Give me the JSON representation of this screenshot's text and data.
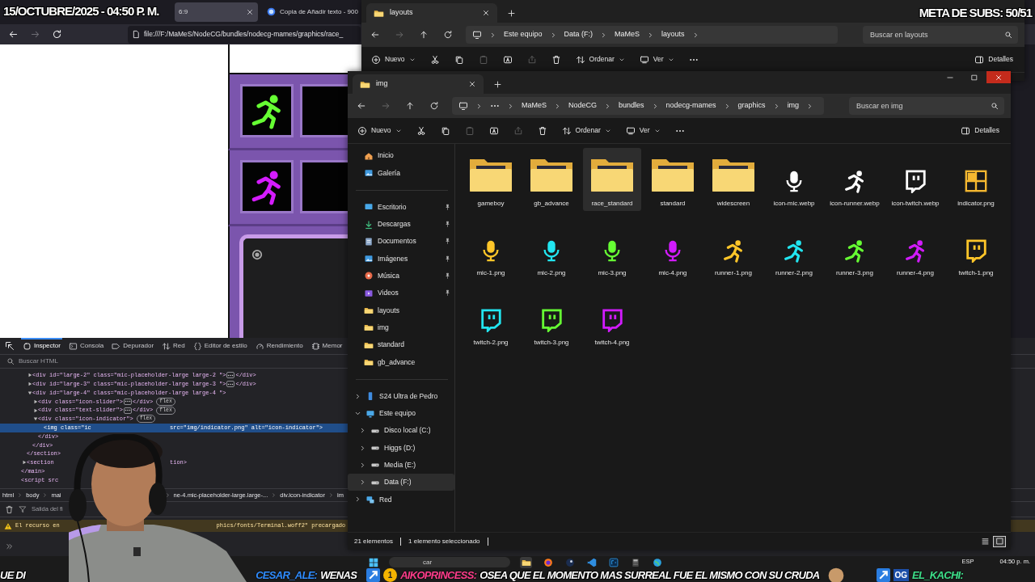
{
  "overlay": {
    "date": "15/OCTUBRE/2025 - 04:50 P. M.",
    "sub_goal": "META DE SUBS: 50/51"
  },
  "browser": {
    "tabs": [
      {
        "label": "6:9",
        "selected": true
      },
      {
        "label": "Copia de Añadir texto - 900",
        "selected": false
      }
    ],
    "nav_buttons": [
      {
        "kind": "back",
        "disabled": false
      },
      {
        "kind": "forward",
        "disabled": true
      },
      {
        "kind": "refresh",
        "disabled": false
      }
    ],
    "url": "file:///F:/MaMeS/NodeCG/bundles/nodecg-mames/graphics/race_",
    "preview": {
      "runners": [
        {
          "color": "#66ff33"
        },
        {
          "color": "#d51cff"
        }
      ]
    },
    "devtools": {
      "tabs": [
        {
          "kind": "inspector",
          "label": "Inspector",
          "selected": true
        },
        {
          "kind": "console",
          "label": "Consola",
          "selected": false
        },
        {
          "kind": "debugger",
          "label": "Depurador",
          "selected": false
        },
        {
          "kind": "network",
          "label": "Red",
          "selected": false
        },
        {
          "kind": "style",
          "label": "Editor de estilo",
          "selected": false
        },
        {
          "kind": "performance",
          "label": "Rendimiento",
          "selected": false
        },
        {
          "kind": "memory",
          "label": "Memor",
          "selected": false
        }
      ],
      "search": {
        "placeholder": "Buscar HTML"
      },
      "tree": [
        {
          "close": "</main>",
          "children": [
            {
              "close": "</section>",
              "children": [
                {
                  "text": "<div id=\"large-2\" class=\"mic-placeholder-large large-2 \">",
                  "expanded": false,
                  "close": "</div>",
                  "selected": false
                },
                {
                  "text": "<div id=\"large-3\" class=\"mic-placeholder-large large-3 \">",
                  "expanded": false,
                  "close": "</div>",
                  "selected": false
                },
                {
                  "text": "<div id=\"large-4\" class=\"mic-placeholder-large large-4 \">",
                  "expanded": true,
                  "close": "</div>",
                  "selected": false,
                  "children": [
                    {
                      "text": "<div class=\"icon-slider\">",
                      "expanded": false,
                      "close": "</div>",
                      "badge": "flex",
                      "selected": false
                    },
                    {
                      "text": "<div class=\"text-slider\">",
                      "expanded": false,
                      "close": "</div>",
                      "badge": "flex",
                      "selected": false
                    },
                    {
                      "text": "<div class=\"icon-indicator\">",
                      "expanded": true,
                      "close": "</div>",
                      "badge": "flex",
                      "selected": false,
                      "children": [
                        {
                          "text": "<img class=\"ic",
                          "text_2": "src=\"img/indicator.png\" alt=\"icon-indicator\">",
                          "selected": true
                        }
                      ]
                    }
                  ]
                }
              ]
            },
            {
              "text": "<section",
              "text_2": "tion>",
              "expanded": false,
              "selected": false
            }
          ]
        },
        {
          "text": "<script src",
          "selected": false
        }
      ],
      "breadcrumb": {
        "left": [
          "html",
          "body",
          "mai"
        ],
        "right": [
          "ne-4.mic-placeholder-large.large-...",
          "div.icon-indicator",
          "im"
        ]
      },
      "filter": {
        "placeholder": "Salida del fi"
      },
      "messages": [
        {
          "kind": "warning",
          "text": "El recurso en",
          "text_2": "phics/fonts/Terminal.woff2\" precargado"
        }
      ]
    }
  },
  "explorers": [
    {
      "tab": "layouts",
      "nav_buttons": [
        {
          "kind": "back",
          "disabled": false
        },
        {
          "kind": "forward",
          "disabled": true
        },
        {
          "kind": "up",
          "disabled": false
        },
        {
          "kind": "refresh",
          "disabled": false
        }
      ],
      "breadcrumb_collapsed": false,
      "breadcrumb": [
        "Este equipo",
        "Data (F:)",
        "MaMeS",
        "layouts"
      ],
      "search": {
        "placeholder": "Buscar en layouts"
      },
      "commands": [
        {
          "kind": "new",
          "label": "Nuevo",
          "disabled": false
        },
        {
          "kind": "cut",
          "disabled": false
        },
        {
          "kind": "copy",
          "disabled": false
        },
        {
          "kind": "paste",
          "disabled": true
        },
        {
          "kind": "rename",
          "disabled": false
        },
        {
          "kind": "share",
          "disabled": true
        },
        {
          "kind": "delete",
          "disabled": false
        },
        {
          "kind": "sort",
          "label": "Ordenar",
          "disabled": false
        },
        {
          "kind": "view",
          "label": "Ver",
          "disabled": false
        },
        {
          "kind": "more",
          "disabled": false
        }
      ],
      "details": "Detalles"
    },
    {
      "tab": "img",
      "controls": [
        {
          "kind": "minimize",
          "hovered": false
        },
        {
          "kind": "maximize",
          "hovered": false
        },
        {
          "kind": "close",
          "hovered": true
        }
      ],
      "nav_buttons": [
        {
          "kind": "back",
          "disabled": false
        },
        {
          "kind": "forward",
          "disabled": true
        },
        {
          "kind": "up",
          "disabled": false
        },
        {
          "kind": "refresh",
          "disabled": false
        }
      ],
      "breadcrumb_collapsed": true,
      "breadcrumb": [
        "MaMeS",
        "NodeCG",
        "bundles",
        "nodecg-mames",
        "graphics",
        "img"
      ],
      "search": {
        "placeholder": "Buscar en img"
      },
      "commands": [
        {
          "kind": "new",
          "label": "Nuevo",
          "disabled": false
        },
        {
          "kind": "cut",
          "disabled": false
        },
        {
          "kind": "copy",
          "disabled": false
        },
        {
          "kind": "paste",
          "disabled": true
        },
        {
          "kind": "rename",
          "disabled": false
        },
        {
          "kind": "share",
          "disabled": true
        },
        {
          "kind": "delete",
          "disabled": false
        },
        {
          "kind": "sort",
          "label": "Ordenar",
          "disabled": false
        },
        {
          "kind": "view",
          "label": "Ver",
          "disabled": false
        },
        {
          "kind": "more",
          "disabled": false
        }
      ],
      "details": "Detalles",
      "quick_access": [
        {
          "label": "Inicio",
          "kind": "home",
          "selected": false
        },
        {
          "label": "Galería",
          "kind": "gallery",
          "selected": false
        }
      ],
      "pinned": [
        {
          "label": "Escritorio",
          "kind": "desktop",
          "pinned": true,
          "selected": false
        },
        {
          "label": "Descargas",
          "kind": "download",
          "pinned": true,
          "selected": false
        },
        {
          "label": "Documentos",
          "kind": "documents",
          "pinned": true,
          "selected": false
        },
        {
          "label": "Imágenes",
          "kind": "pictures",
          "pinned": true,
          "selected": false
        },
        {
          "label": "Música",
          "kind": "music",
          "pinned": true,
          "selected": false
        },
        {
          "label": "Videos",
          "kind": "videos",
          "pinned": true,
          "selected": false
        },
        {
          "label": "layouts",
          "kind": "folder",
          "pinned": false,
          "selected": false
        },
        {
          "label": "img",
          "kind": "folder",
          "pinned": false,
          "selected": false
        },
        {
          "label": "standard",
          "kind": "folder",
          "pinned": false,
          "selected": false
        },
        {
          "label": "gb_advance",
          "kind": "folder",
          "pinned": false,
          "selected": false
        }
      ],
      "tree": [
        {
          "label": "S24 Ultra de Pedro",
          "kind": "phone",
          "expanded": false,
          "selected": false
        },
        {
          "label": "Este equipo",
          "kind": "pc",
          "expanded": true,
          "selected": false,
          "children": [
            {
              "label": "Disco local (C:)",
              "kind": "drive",
              "expanded": false,
              "selected": false
            },
            {
              "label": "Higgs (D:)",
              "kind": "drive",
              "expanded": false,
              "selected": false
            },
            {
              "label": "Media (E:)",
              "kind": "drive",
              "expanded": false,
              "selected": false
            },
            {
              "label": "Data (F:)",
              "kind": "drive",
              "expanded": false,
              "selected": true
            }
          ]
        },
        {
          "label": "Red",
          "kind": "network",
          "expanded": false,
          "selected": false
        }
      ],
      "files": [
        {
          "name": "gameboy",
          "kind": "folder",
          "selected": false
        },
        {
          "name": "gb_advance",
          "kind": "folder",
          "selected": false
        },
        {
          "name": "race_standard",
          "kind": "folder",
          "selected": true
        },
        {
          "name": "standard",
          "kind": "folder",
          "selected": false
        },
        {
          "name": "widescreen",
          "kind": "folder",
          "selected": false
        },
        {
          "name": "icon-mic.webp",
          "kind": "mic",
          "color": "#ffffff",
          "selected": false
        },
        {
          "name": "icon-runner.webp",
          "kind": "runner",
          "color": "#ffffff",
          "selected": false
        },
        {
          "name": "icon-twitch.webp",
          "kind": "twitch",
          "color": "#ffffff",
          "selected": false
        },
        {
          "name": "indicator.png",
          "kind": "indicator",
          "color": "#f5b830",
          "selected": false
        },
        {
          "name": "mic-1.png",
          "kind": "mic",
          "color": "#ffc629",
          "selected": false
        },
        {
          "name": "mic-2.png",
          "kind": "mic",
          "color": "#22e5f0",
          "selected": false
        },
        {
          "name": "mic-3.png",
          "kind": "mic",
          "color": "#66ff33",
          "selected": false
        },
        {
          "name": "mic-4.png",
          "kind": "mic",
          "color": "#d21bff",
          "selected": false
        },
        {
          "name": "runner-1.png",
          "kind": "runner",
          "color": "#ffc629",
          "selected": false
        },
        {
          "name": "runner-2.png",
          "kind": "runner",
          "color": "#22e5f0",
          "selected": false
        },
        {
          "name": "runner-3.png",
          "kind": "runner",
          "color": "#66ff33",
          "selected": false
        },
        {
          "name": "runner-4.png",
          "kind": "runner",
          "color": "#d21bff",
          "selected": false
        },
        {
          "name": "twitch-1.png",
          "kind": "twitch",
          "color": "#ffc629",
          "selected": false
        },
        {
          "name": "twitch-2.png",
          "kind": "twitch",
          "color": "#22e5f0",
          "selected": false
        },
        {
          "name": "twitch-3.png",
          "kind": "twitch",
          "color": "#66ff33",
          "selected": false
        },
        {
          "name": "twitch-4.png",
          "kind": "twitch",
          "color": "#d21bff",
          "selected": false
        }
      ],
      "status": [
        "21 elementos",
        "1 elemento seleccionado"
      ],
      "views": [
        {
          "kind": "details",
          "selected": false
        },
        {
          "kind": "tiles",
          "selected": true
        }
      ]
    }
  ],
  "taskbar": {
    "search": {
      "placeholder": "car"
    },
    "apps": [
      {
        "kind": "folder",
        "selected": true
      },
      {
        "kind": "browser",
        "selected": false
      },
      {
        "kind": "disc",
        "selected": false
      },
      {
        "kind": "code",
        "selected": false
      },
      {
        "kind": "image-editor",
        "selected": false
      },
      {
        "kind": "calculator",
        "selected": false
      },
      {
        "kind": "globe",
        "selected": false
      }
    ],
    "language": "ESP",
    "time": "04:50 p. m."
  },
  "ticker": {
    "fragment": "UE DI",
    "messages": [
      {
        "user": "CESAR_ALE:",
        "text": "WENAS",
        "color": "#2f8cff",
        "emote": false
      },
      {
        "user": "AIKOPRINCESS:",
        "text": "OSEA QUE EL MOMENTO MAS SURREAL FUE EL MISMO CON SU CRUDA",
        "color": "#ff3d8b",
        "badges": [
          {
            "kind": "arrow"
          },
          {
            "kind": "count",
            "text": "1"
          }
        ],
        "emote": true
      },
      {
        "user": "EL_KACHI:",
        "color": "#3ee08a",
        "badges": [
          {
            "kind": "arrow"
          },
          {
            "kind": "tag",
            "text": "OG"
          }
        ],
        "emote": false
      }
    ]
  }
}
